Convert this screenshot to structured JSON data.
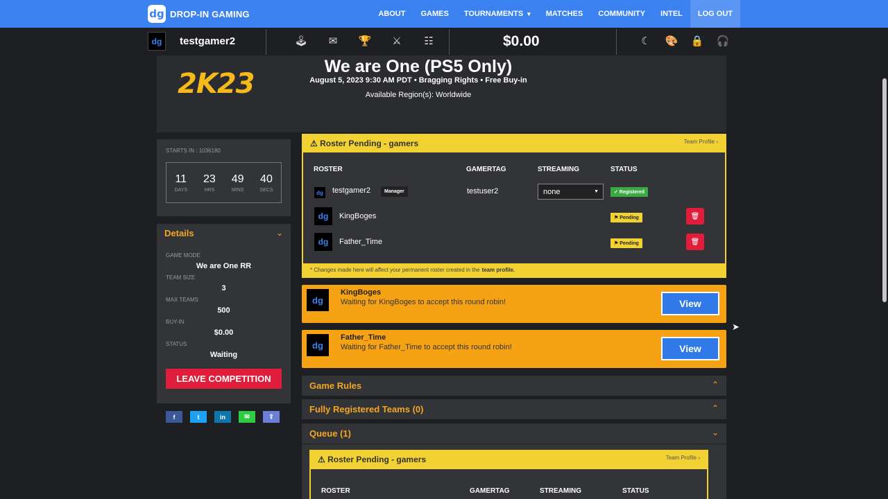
{
  "brand": {
    "logo": "dg",
    "name": "DROP-IN GAMING"
  },
  "nav": {
    "about": "ABOUT",
    "games": "GAMES",
    "tournaments": "TOURNAMENTS",
    "tournaments_caret": "▾",
    "matches": "MATCHES",
    "community": "COMMUNITY",
    "intel": "INTEL",
    "logout": "LOG OUT"
  },
  "user": {
    "avatar": "dg",
    "name": "testgamer2",
    "balance": "$0.00"
  },
  "subbar_icons": [
    "controller-icon",
    "inbox-icon",
    "trophy-icon",
    "versus-icon",
    "bracket-icon"
  ],
  "right_icons": [
    "moon-icon",
    "palette-icon",
    "lock-icon",
    "headset-icon"
  ],
  "competition": {
    "game_logo": "2K23",
    "title": "We are One (PS5 Only)",
    "meta": "August 5, 2023 9:30 AM PDT • Bragging Rights • Free Buy-in",
    "region": "Available Region(s): Worldwide"
  },
  "countdown": {
    "label": "STARTS IN : 1036180",
    "days": "11",
    "days_unit": "DAYS",
    "hrs": "23",
    "hrs_unit": "HRS",
    "mins": "49",
    "mins_unit": "MINS",
    "secs": "40",
    "secs_unit": "SECS"
  },
  "details": {
    "heading": "Details",
    "game_mode_label": "GAME MODE",
    "game_mode": "We are One RR",
    "team_size_label": "TEAM SIZE",
    "team_size": "3",
    "max_teams_label": "MAX TEAMS",
    "max_teams": "500",
    "buy_in_label": "BUY-IN",
    "buy_in": "$0.00",
    "status_label": "STATUS",
    "status": "Waiting",
    "leave_button": "LEAVE COMPETITION"
  },
  "share": [
    {
      "label": "f",
      "color": "#3b5998"
    },
    {
      "label": "t",
      "color": "#1da1f2"
    },
    {
      "label": "in",
      "color": "#0e76a8"
    },
    {
      "label": "✉",
      "color": "#2ecc40"
    },
    {
      "label": "⇪",
      "color": "#6c7fd8"
    }
  ],
  "roster": {
    "title": "⚠ Roster Pending - gamers",
    "team_profile": "Team Profile ›",
    "headers": {
      "roster": "ROSTER",
      "gamertag": "GAMERTAG",
      "streaming": "STREAMING",
      "status": "STATUS"
    },
    "rows": [
      {
        "avatar": "dg",
        "name": "testgamer2",
        "badge": "Manager",
        "gamertag": "testuser2",
        "streaming": "none",
        "status": "✓ Registered"
      },
      {
        "avatar": "dg",
        "name": "KingBoges",
        "gamertag": "",
        "status": "⚑ Pending"
      },
      {
        "avatar": "dg",
        "name": "Father_Time",
        "gamertag": "",
        "status": "⚑ Pending"
      }
    ],
    "footer_note": "* Changes made here will affect your permanent roster created in the",
    "footer_link": "team profile."
  },
  "invites": [
    {
      "avatar": "dg",
      "name": "KingBoges",
      "message": "Waiting for KingBoges to accept this round robin!",
      "button": "View"
    },
    {
      "avatar": "dg",
      "name": "Father_Time",
      "message": "Waiting for Father_Time to accept this round robin!",
      "button": "View"
    }
  ],
  "sections": {
    "game_rules": "Game Rules",
    "registered_teams": "Fully Registered Teams (0)",
    "queue": "Queue (1)"
  },
  "queue_card": {
    "title": "⚠ Roster Pending - gamers",
    "team_profile": "Team Profile ›",
    "headers": {
      "roster": "ROSTER",
      "gamertag": "GAMERTAG",
      "streaming": "STREAMING",
      "status": "STATUS"
    }
  },
  "colors": {
    "nav": "#3b82f0",
    "accent_orange": "#f5a623",
    "pending_yellow": "#f2d232",
    "danger": "#e01e3c",
    "success": "#3caa43"
  }
}
